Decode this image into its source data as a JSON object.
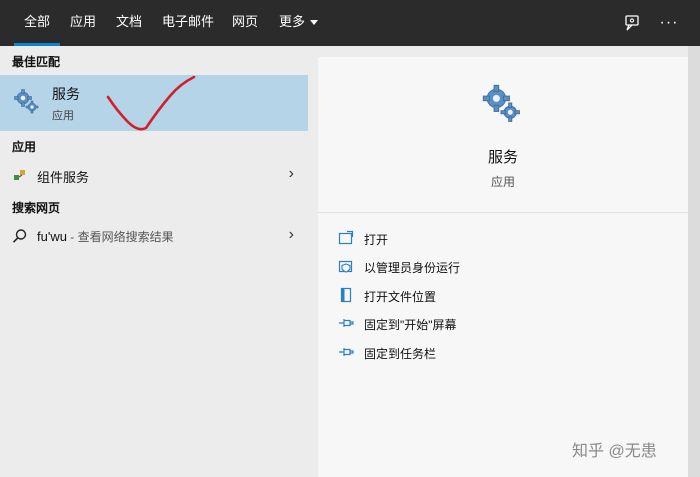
{
  "tabs": [
    {
      "label": "全部",
      "active": true
    },
    {
      "label": "应用"
    },
    {
      "label": "文档"
    },
    {
      "label": "电子邮件"
    },
    {
      "label": "网页"
    },
    {
      "label": "更多"
    }
  ],
  "toolbar": {
    "feedback_icon": "feedback-icon",
    "more_icon": "more-options-icon",
    "more_text": "···"
  },
  "results": {
    "best_match_header": "最佳匹配",
    "best_match": {
      "title": "服务",
      "subtitle": "应用",
      "icon": "gear-icon"
    },
    "apps_header": "应用",
    "apps": [
      {
        "label": "组件服务",
        "icon": "component-services-icon"
      }
    ],
    "web_header": "搜索网页",
    "web": {
      "query": "fu'wu",
      "hint": " - 查看网络搜索结果",
      "icon": "search-icon"
    }
  },
  "preview": {
    "name": "服务",
    "type": "应用",
    "icon": "gear-icon",
    "actions": [
      {
        "label": "打开",
        "icon": "open-icon"
      },
      {
        "label": "以管理员身份运行",
        "icon": "run-as-admin-icon"
      },
      {
        "label": "打开文件位置",
        "icon": "file-location-icon"
      },
      {
        "label": "固定到\"开始\"屏幕",
        "icon": "pin-icon"
      },
      {
        "label": "固定到任务栏",
        "icon": "pin-icon"
      }
    ]
  },
  "watermark": "知乎 @无患",
  "colors": {
    "topbar": "#2b2b2b",
    "accent": "#0a84d6",
    "selected": "#b6d4e8",
    "annotation": "#d0202a"
  }
}
